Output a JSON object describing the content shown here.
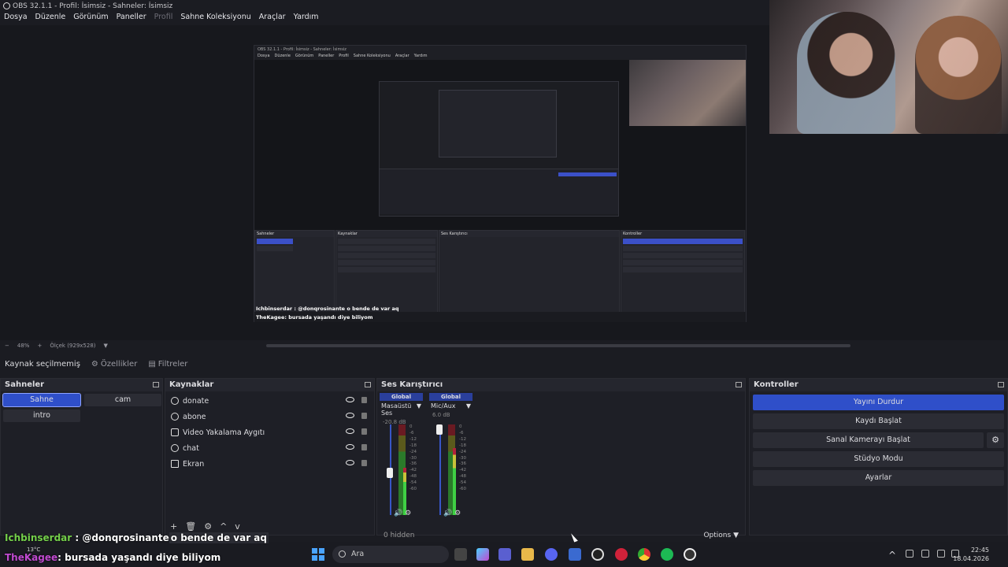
{
  "window": {
    "title": "OBS 32.1.1 - Profil: İsimsiz - Sahneler: İsimsiz"
  },
  "menu": [
    "Dosya",
    "Düzenle",
    "Görünüm",
    "Paneller",
    "Profil",
    "Sahne Koleksiyonu",
    "Araçlar",
    "Yardım"
  ],
  "zoom": {
    "level": "48%",
    "scale": "Ölçek (929x528)"
  },
  "source_bar": {
    "status": "Kaynak seçilmemiş",
    "properties": "Özellikler",
    "filters": "Filtreler"
  },
  "scenes": {
    "title": "Sahneler",
    "items": [
      "Sahne",
      "cam",
      "intro"
    ],
    "active": "Sahne"
  },
  "sources": {
    "title": "Kaynaklar",
    "items": [
      {
        "label": "donate",
        "icon": "globe-icon"
      },
      {
        "label": "abone",
        "icon": "globe-icon"
      },
      {
        "label": "Video Yakalama Aygıtı",
        "icon": "camera-icon"
      },
      {
        "label": "chat",
        "icon": "globe-icon"
      },
      {
        "label": "Ekran",
        "icon": "monitor-icon"
      }
    ],
    "tools": [
      "+",
      "🗑",
      "⚙",
      "^",
      "v"
    ]
  },
  "mixer": {
    "title": "Ses Karıştırıcı",
    "channels": [
      {
        "scope": "Global",
        "name": "Masaüstü Ses",
        "db": "-20.8 dB",
        "fader_level": 0.48
      },
      {
        "scope": "Global",
        "name": "Mic/Aux",
        "db": "6.0 dB",
        "fader_level": 1.0
      }
    ],
    "scale": [
      "0",
      "-6",
      "-12",
      "-18",
      "-24",
      "-30",
      "-36",
      "-42",
      "-48",
      "-54",
      "-60"
    ],
    "footer": "0 hidden",
    "options": "Options"
  },
  "controls": {
    "title": "Kontroller",
    "buttons": [
      "Yayını Durdur",
      "Kaydı Başlat",
      "Sanal Kamerayı Başlat",
      "Stüdyo Modu",
      "Ayarlar"
    ]
  },
  "chat": {
    "line1": {
      "user": "Ichbinserdar",
      "sep": " : ",
      "mention": "@donqrosinante",
      "text": "o bende de var aq"
    },
    "line2": {
      "user": "TheKagee",
      "sep": ": ",
      "text": "bursada yaşandı diye biliyom"
    }
  },
  "taskbar": {
    "weather": "13°C",
    "search": "Ara",
    "time": "22:45",
    "date": "18.04.2026"
  },
  "nested": {
    "title": "OBS 32.1.1 - Profil: İsimsiz - Sahneler: İsimsiz",
    "chat1": "Ichbinserdar : @donqrosinante o bende de var aq",
    "chat2": "TheKagee: bursada yaşandı diye biliyom"
  },
  "colors": {
    "accent": "#2f4fc9",
    "panel": "#1e1f26",
    "bg": "#17181d"
  }
}
